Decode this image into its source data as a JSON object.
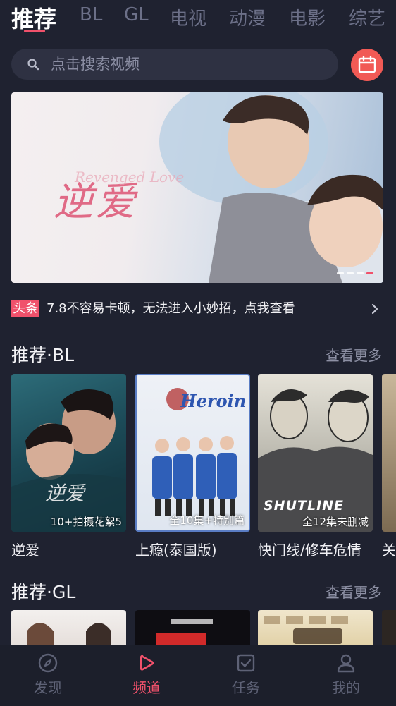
{
  "top_tabs": [
    {
      "label": "推荐",
      "active": true
    },
    {
      "label": "BL"
    },
    {
      "label": "GL"
    },
    {
      "label": "电视"
    },
    {
      "label": "动漫"
    },
    {
      "label": "电影"
    },
    {
      "label": "综艺"
    }
  ],
  "search": {
    "placeholder": "点击搜索视频",
    "icon": "search-icon"
  },
  "calendar_button": {
    "icon": "calendar-icon"
  },
  "banner": {
    "title_art": "逆爱",
    "subtitle_art": "Revenged Love",
    "indicator_count": 4,
    "active_index": 3
  },
  "ticker": {
    "tag": "头条",
    "text": "7.8不容易卡顿，无法进入小妙招，点我查看"
  },
  "section_bl": {
    "title": "推荐·BL",
    "more": "查看更多",
    "items": [
      {
        "title": "逆爱",
        "badge": "10+拍摄花絮5",
        "poster_art": "逆爱"
      },
      {
        "title": "上瘾(泰国版)",
        "badge": "全10集+特别篇",
        "poster_art": "Heroin"
      },
      {
        "title": "快门线/修车危情",
        "badge": "全12集未删减",
        "poster_art": "SHUTLINE"
      },
      {
        "title": "关",
        "badge": ""
      }
    ]
  },
  "section_gl": {
    "title": "推荐·GL",
    "more": "查看更多"
  },
  "bottom_nav": [
    {
      "label": "发现",
      "icon": "compass-icon"
    },
    {
      "label": "频道",
      "icon": "play-icon",
      "active": true
    },
    {
      "label": "任务",
      "icon": "task-check-icon"
    },
    {
      "label": "我的",
      "icon": "user-icon"
    }
  ],
  "colors": {
    "accent": "#f0516b",
    "background": "#1f2230",
    "calendar_button": "#f15a55"
  }
}
